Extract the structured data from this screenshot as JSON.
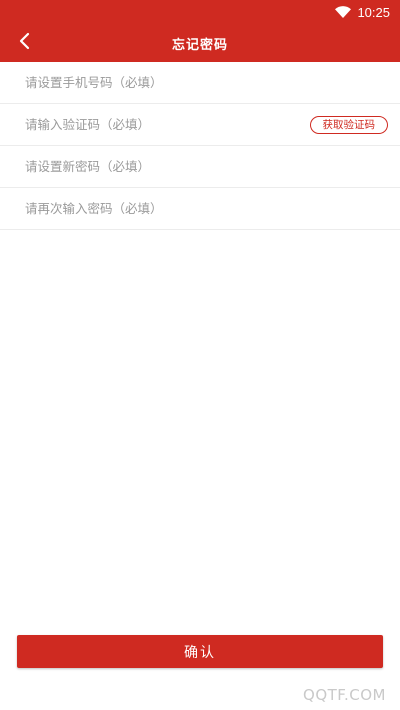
{
  "status_bar": {
    "time": "10:25",
    "icons": [
      "wifi-icon"
    ]
  },
  "header": {
    "title": "忘记密码",
    "back_icon": "back-arrow-icon"
  },
  "form": {
    "phone_placeholder": "请设置手机号码（必填）",
    "code_placeholder": "请输入验证码（必填）",
    "get_code_label": "获取验证码",
    "new_password_placeholder": "请设置新密码（必填）",
    "confirm_password_placeholder": "请再次输入密码（必填）"
  },
  "footer": {
    "confirm_label": "确认"
  },
  "watermark": "QQTF.COM",
  "colors": {
    "accent": "#cf2a21",
    "placeholder": "#9a9a9a",
    "divider": "#ececec"
  }
}
